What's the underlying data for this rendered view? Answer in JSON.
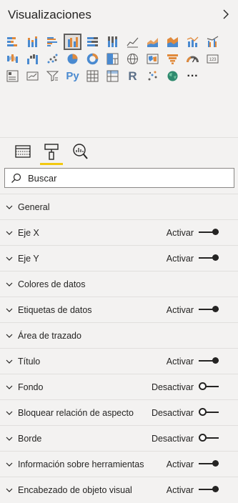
{
  "header": {
    "title": "Visualizaciones"
  },
  "visuals": {
    "rows": [
      [
        "stacked-bar-chart-icon",
        "stacked-column-chart-icon",
        "clustered-bar-chart-icon",
        "clustered-column-chart-icon",
        "100-stacked-bar-chart-icon",
        "100-stacked-column-chart-icon",
        "line-chart-icon",
        "area-chart-icon",
        "stacked-area-chart-icon",
        "line-and-stacked-column-chart-icon",
        "line-and-clustered-column-chart-icon"
      ],
      [
        "ribbon-chart-icon",
        "waterfall-chart-icon",
        "scatter-chart-icon",
        "pie-chart-icon",
        "donut-chart-icon",
        "treemap-icon",
        "map-icon",
        "filled-map-icon",
        "funnel-icon",
        "gauge-icon",
        "card-icon"
      ],
      [
        "multi-row-card-icon",
        "kpi-icon",
        "slicer-icon",
        "python-visual-icon",
        "table-icon",
        "matrix-icon",
        "r-visual-icon",
        "arcgis-map-icon",
        "globe-icon",
        "more-visuals-icon"
      ]
    ],
    "selected": "clustered-column-chart-icon",
    "python_label": "Py",
    "r_label": "R",
    "more_label": "···"
  },
  "pane_tabs": [
    "fields-tab-icon",
    "format-paint-roller-icon",
    "analytics-magnifier-icon"
  ],
  "search": {
    "placeholder": "Buscar"
  },
  "cards": [
    {
      "name": "General",
      "status": "",
      "toggle": ""
    },
    {
      "name": "Eje X",
      "status": "Activar",
      "toggle": "on"
    },
    {
      "name": "Eje Y",
      "status": "Activar",
      "toggle": "on"
    },
    {
      "name": "Colores de datos",
      "status": "",
      "toggle": ""
    },
    {
      "name": "Etiquetas de datos",
      "status": "Activar",
      "toggle": "on"
    },
    {
      "name": "Área de trazado",
      "status": "",
      "toggle": ""
    },
    {
      "name": "Título",
      "status": "Activar",
      "toggle": "on"
    },
    {
      "name": "Fondo",
      "status": "Desactivar",
      "toggle": "off"
    },
    {
      "name": "Bloquear relación de aspecto",
      "status": "Desactivar",
      "toggle": "off"
    },
    {
      "name": "Borde",
      "status": "Desactivar",
      "toggle": "off"
    },
    {
      "name": "Información sobre herramientas",
      "status": "Activar",
      "toggle": "on"
    },
    {
      "name": "Encabezado de objeto visual",
      "status": "Activar",
      "toggle": "on"
    }
  ],
  "colors": {
    "accent": "#f2c811",
    "text": "#252423",
    "chart_blue": "#4a8ad0",
    "chart_orange": "#e08a3c"
  }
}
